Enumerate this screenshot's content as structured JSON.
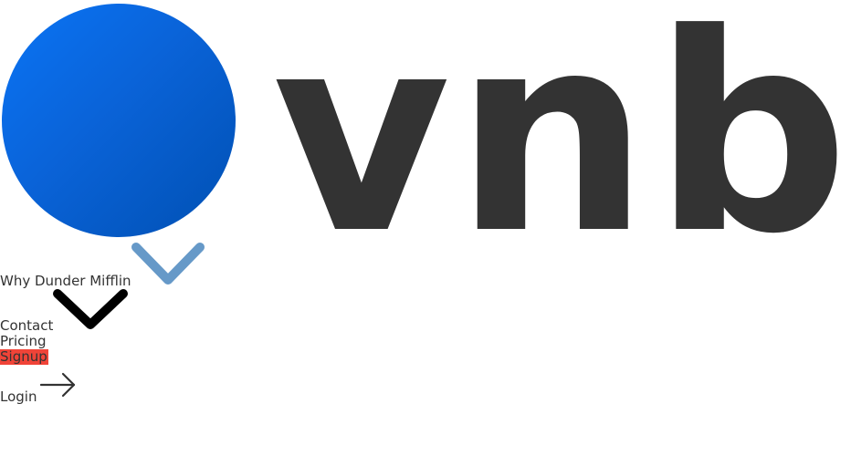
{
  "brand": {
    "wordmark": "vnb",
    "logo_icon": "blue-circle-logo",
    "colors": {
      "logo_gradient_start": "#0a74f5",
      "logo_gradient_end": "#0050b3",
      "wordmark": "#333333"
    }
  },
  "nav": {
    "why": "Why Dunder Mifflin",
    "contact": "Contact",
    "pricing": "Pricing",
    "signup": "Signup",
    "login": "Login"
  },
  "icons": {
    "dropdown_primary": "chevron-down-icon",
    "dropdown_secondary": "chevron-down-icon",
    "login_arrow": "arrow-right-icon"
  },
  "colors": {
    "signup_background": "#f04438",
    "chevron_blue": "#6699c8",
    "chevron_black": "#000000",
    "text": "#333333"
  }
}
